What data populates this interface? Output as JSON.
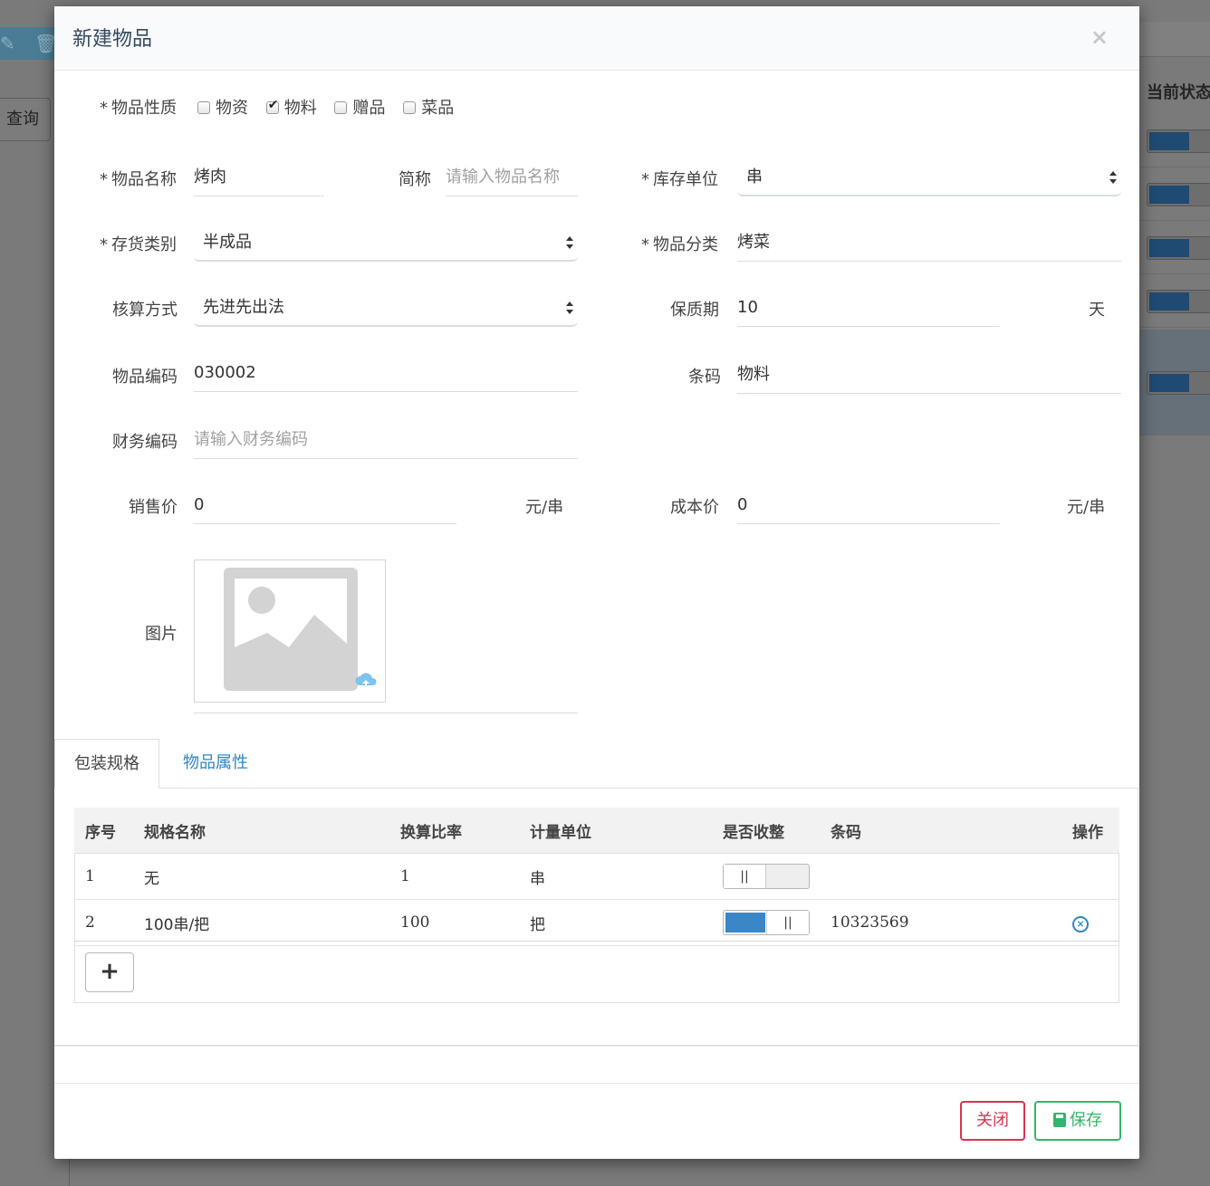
{
  "background": {
    "query_button": "查询",
    "status_header": "当前状态"
  },
  "modal": {
    "title": "新建物品",
    "close_icon": "×"
  },
  "form": {
    "nature": {
      "label": "物品性质",
      "options": [
        {
          "label": "物资",
          "checked": false
        },
        {
          "label": "物料",
          "checked": true
        },
        {
          "label": "赠品",
          "checked": false
        },
        {
          "label": "菜品",
          "checked": false
        }
      ]
    },
    "name": {
      "label": "物品名称",
      "value": "烤肉"
    },
    "short_name": {
      "label": "简称",
      "placeholder": "请输入物品名称"
    },
    "stock_unit": {
      "label": "库存单位",
      "value": "串"
    },
    "inventory_type": {
      "label": "存货类别",
      "value": "半成品"
    },
    "category": {
      "label": "物品分类",
      "value": "烤菜"
    },
    "costing_method": {
      "label": "核算方式",
      "value": "先进先出法"
    },
    "shelf_life": {
      "label": "保质期",
      "value": "10",
      "unit": "天"
    },
    "code": {
      "label": "物品编码",
      "value": "030002"
    },
    "barcode": {
      "label": "条码",
      "value": "物料"
    },
    "finance_code": {
      "label": "财务编码",
      "placeholder": "请输入财务编码"
    },
    "sale_price": {
      "label": "销售价",
      "value": "0",
      "unit": "元/串"
    },
    "cost_price": {
      "label": "成本价",
      "value": "0",
      "unit": "元/串"
    },
    "image": {
      "label": "图片",
      "icon": "image-placeholder-icon",
      "upload_icon": "cloud-upload-icon"
    }
  },
  "tabs": [
    {
      "label": "包装规格",
      "active": true
    },
    {
      "label": "物品属性",
      "active": false
    }
  ],
  "spec_table": {
    "columns": [
      "序号",
      "规格名称",
      "换算比率",
      "计量单位",
      "是否收整",
      "条码",
      "操作"
    ],
    "rows": [
      {
        "no": "1",
        "name": "无",
        "ratio": "1",
        "unit": "串",
        "whole": false,
        "barcode": "",
        "deletable": false
      },
      {
        "no": "2",
        "name": "100串/把",
        "ratio": "100",
        "unit": "把",
        "whole": true,
        "barcode": "10323569",
        "deletable": true
      }
    ],
    "toggle_knob": "||",
    "add_button": "+"
  },
  "footer": {
    "close_label": "关闭",
    "save_label": "保存"
  },
  "colors": {
    "primary_blue": "#3a87c8",
    "link_blue": "#2c86c7",
    "close_red": "#d9334f",
    "save_green": "#35b56b"
  }
}
